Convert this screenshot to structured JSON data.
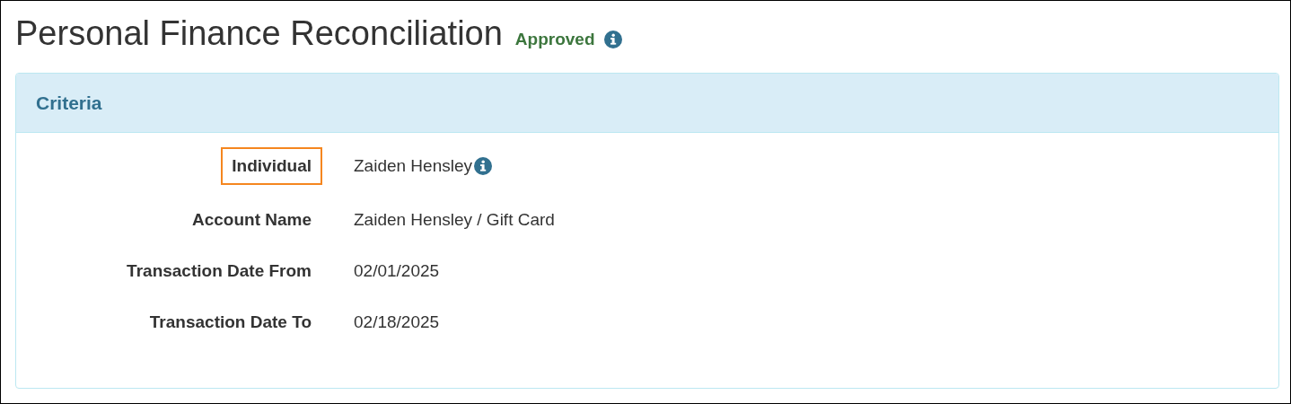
{
  "page": {
    "title": "Personal Finance Reconciliation",
    "status": "Approved",
    "status_info": true
  },
  "panel": {
    "heading": "Criteria",
    "fields": [
      {
        "label": "Individual",
        "value": "Zaiden Hensley",
        "info": true,
        "highlighted": true
      },
      {
        "label": "Account Name",
        "value": "Zaiden Hensley / Gift Card",
        "info": false,
        "highlighted": false
      },
      {
        "label": "Transaction Date From",
        "value": "02/01/2025",
        "info": false,
        "highlighted": false
      },
      {
        "label": "Transaction Date To",
        "value": "02/18/2025",
        "info": false,
        "highlighted": false
      }
    ]
  }
}
